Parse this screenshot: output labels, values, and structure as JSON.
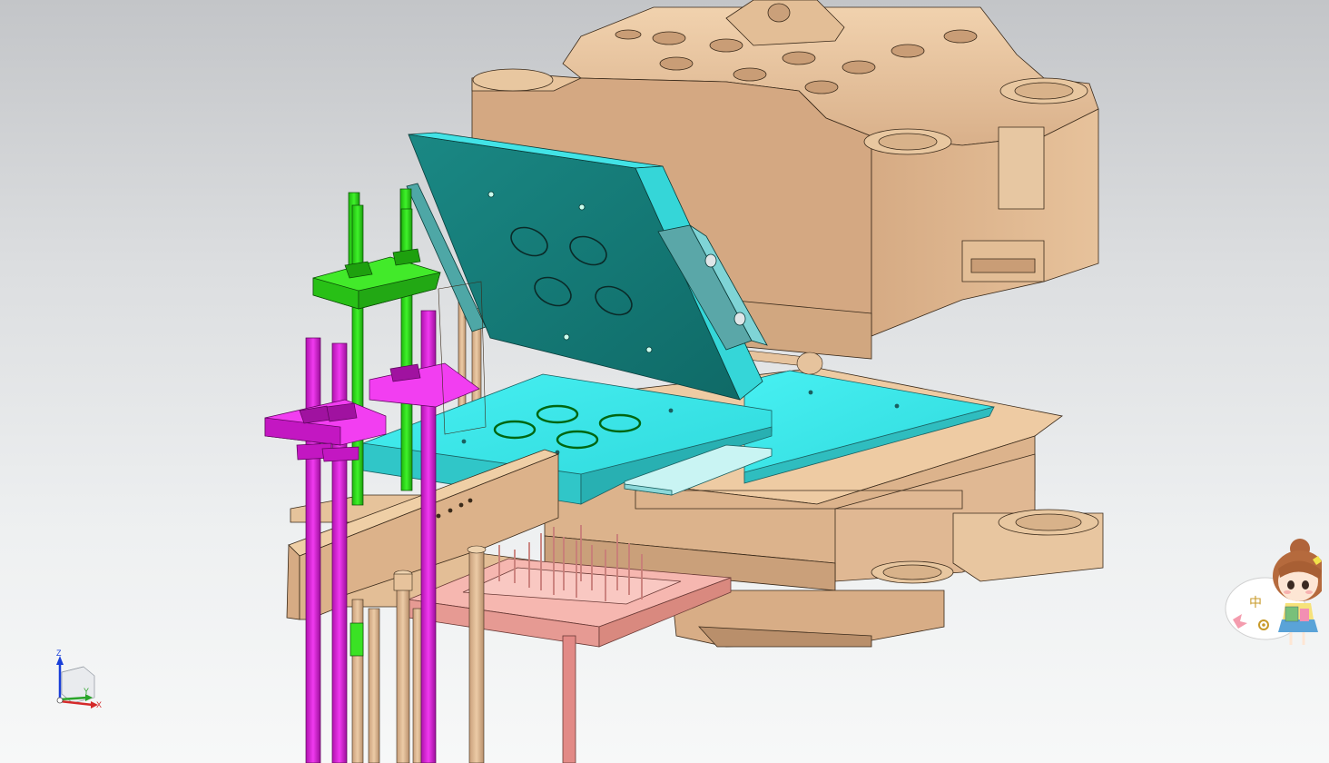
{
  "window": {
    "title": ""
  },
  "viewport": {
    "background_top": "#c3c5c8",
    "background_bottom": "#f7f8f8"
  },
  "colors": {
    "mold_base": "#e9c59d",
    "mold_base_shadow": "#caa07a",
    "mold_base_dark": "#b98f6b",
    "cyan_plate": "#39e7ea",
    "cyan_plate_side": "#2fbdbf",
    "teal_plate": "#157b78",
    "green_part": "#31e41c",
    "magenta_part": "#e11de0",
    "pink_plate": "#f2a9a3",
    "ejector_pin": "#c87d78",
    "edge": "#3a2a1a"
  },
  "triad": {
    "z_label": "Z",
    "y_label": "Y",
    "x_label": "X"
  },
  "icons": {
    "triad": "axis-triad-icon",
    "ime": "ime-status-mascot-icon",
    "ime_lang": "中"
  }
}
